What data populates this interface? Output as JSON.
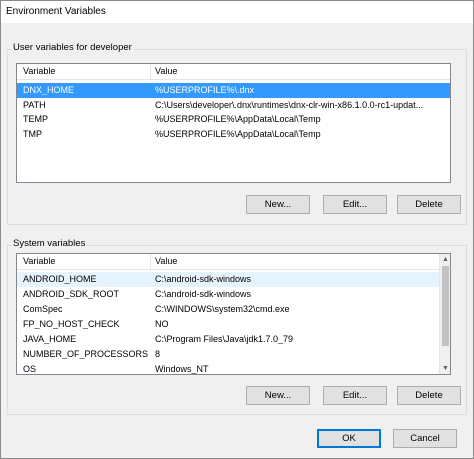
{
  "window": {
    "title": "Environment Variables"
  },
  "user_vars": {
    "group_label": "User variables for developer",
    "columns": [
      "Variable",
      "Value"
    ],
    "rows": [
      {
        "variable": "DNX_HOME",
        "value": "%USERPROFILE%\\.dnx",
        "selected": true
      },
      {
        "variable": "PATH",
        "value": "C:\\Users\\developer\\.dnx\\runtimes\\dnx-clr-win-x86.1.0.0-rc1-updat...",
        "selected": false
      },
      {
        "variable": "TEMP",
        "value": "%USERPROFILE%\\AppData\\Local\\Temp",
        "selected": false
      },
      {
        "variable": "TMP",
        "value": "%USERPROFILE%\\AppData\\Local\\Temp",
        "selected": false
      }
    ],
    "buttons": {
      "new": "New...",
      "edit": "Edit...",
      "delete": "Delete"
    }
  },
  "system_vars": {
    "group_label": "System variables",
    "columns": [
      "Variable",
      "Value"
    ],
    "rows": [
      {
        "variable": "ANDROID_HOME",
        "value": "C:\\android-sdk-windows"
      },
      {
        "variable": "ANDROID_SDK_ROOT",
        "value": "C:\\android-sdk-windows"
      },
      {
        "variable": "ComSpec",
        "value": "C:\\WINDOWS\\system32\\cmd.exe"
      },
      {
        "variable": "FP_NO_HOST_CHECK",
        "value": "NO"
      },
      {
        "variable": "JAVA_HOME",
        "value": "C:\\Program Files\\Java\\jdk1.7.0_79"
      },
      {
        "variable": "NUMBER_OF_PROCESSORS",
        "value": "8"
      },
      {
        "variable": "OS",
        "value": "Windows_NT"
      }
    ],
    "buttons": {
      "new": "New...",
      "edit": "Edit...",
      "delete": "Delete"
    }
  },
  "dialog_buttons": {
    "ok": "OK",
    "cancel": "Cancel"
  },
  "colors": {
    "selection": "#3399ff",
    "dialog_bg": "#f0f0f0",
    "default_button_border": "#0078d7"
  }
}
